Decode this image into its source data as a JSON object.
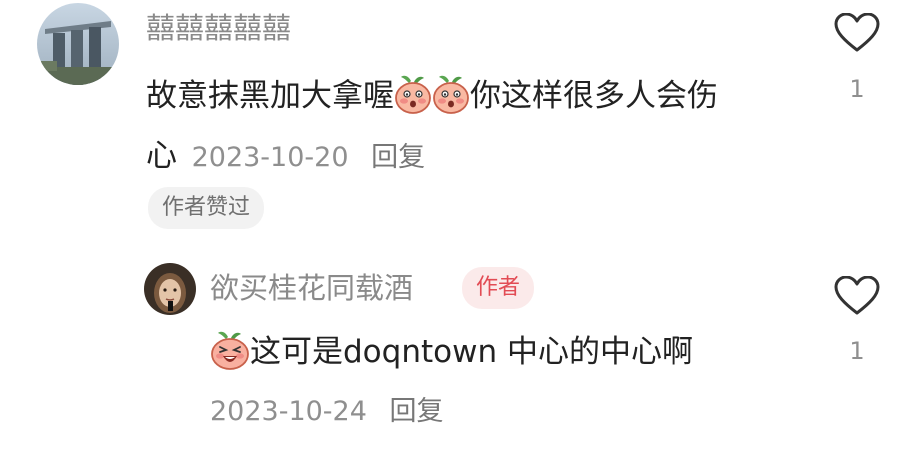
{
  "comment": {
    "username": "囍囍囍囍囍",
    "text_part1": "故意抹黑加大拿喔",
    "emoji_1": "peach-shy-emoji",
    "emoji_2": "peach-shy-emoji",
    "text_part2": "你这样很多人会伤",
    "text_line2": "心",
    "date": "2023-10-20",
    "reply_label": "回复",
    "liked_badge": "作者赞过",
    "like_count": "1"
  },
  "reply": {
    "username": "欲买桂花同载酒",
    "author_badge": "作者",
    "emoji": "peach-laugh-emoji",
    "text": "这可是doqntown 中心的中心啊",
    "date": "2023-10-24",
    "reply_label": "回复",
    "like_count": "1"
  },
  "colors": {
    "username": "#8a8a8a",
    "text": "#222222",
    "meta": "#8f8f8f",
    "author_badge_bg": "#fbeaea",
    "author_badge_text": "#e24b54",
    "liked_badge_bg": "#f2f2f2"
  }
}
